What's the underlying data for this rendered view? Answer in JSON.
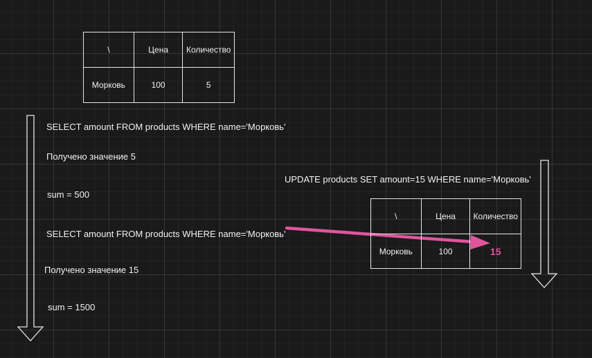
{
  "table_before": {
    "headers": [
      "\\",
      "Цена",
      "Количество"
    ],
    "row": [
      "Морковь",
      "100",
      "5"
    ]
  },
  "table_after": {
    "headers": [
      "\\",
      "Цена",
      "Количество"
    ],
    "row": [
      "Морковь",
      "100",
      "15"
    ]
  },
  "left_steps": [
    "SELECT amount FROM products WHERE name='Морковь'",
    "Получено значение 5",
    "sum = 500",
    "SELECT amount FROM products WHERE name='Морковь'",
    "Получено значение 15",
    "sum = 1500"
  ],
  "update_query": "UPDATE products SET amount=15 WHERE name='Морковь'",
  "colors": {
    "background": "#1a1a1a",
    "line": "#e6e6e6",
    "highlight": "#e0559d"
  }
}
